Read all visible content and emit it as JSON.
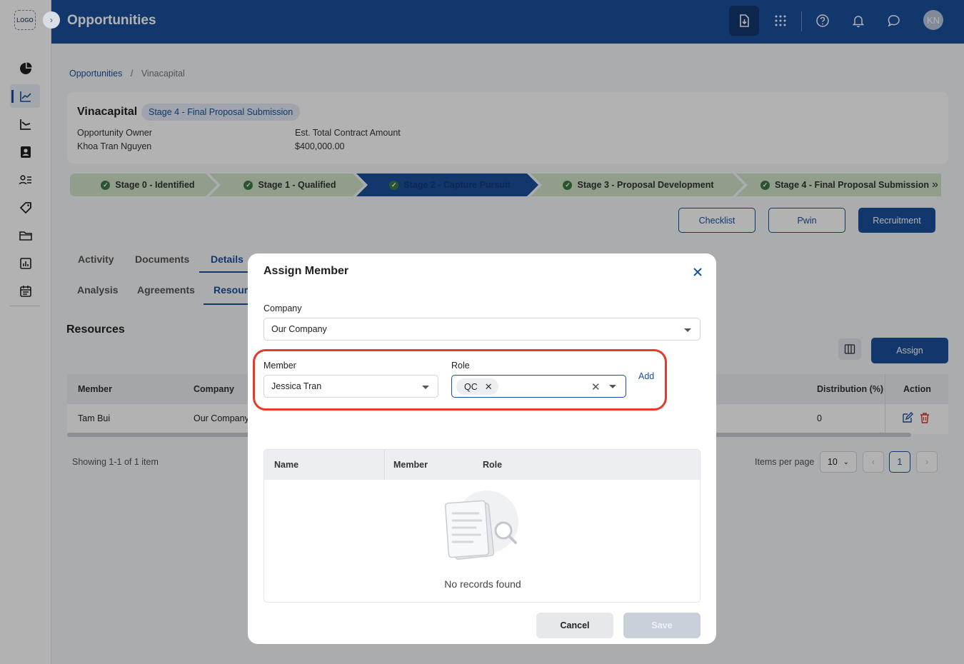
{
  "app": {
    "logo_text": "LOGO",
    "page_title": "Opportunities",
    "avatar_initials": "KN"
  },
  "sidebar": {
    "items": [
      {
        "icon": "dashboard-icon"
      },
      {
        "icon": "trend-chart-icon",
        "active": true
      },
      {
        "icon": "line-chart-icon"
      },
      {
        "icon": "contacts-icon"
      },
      {
        "icon": "people-list-icon"
      },
      {
        "icon": "tag-icon"
      },
      {
        "icon": "folder-icon"
      },
      {
        "icon": "report-icon"
      },
      {
        "icon": "calendar-icon"
      }
    ]
  },
  "header": {
    "icons": [
      "download-icon",
      "apps-grid-icon",
      "help-icon",
      "notification-bell-icon",
      "chat-icon"
    ]
  },
  "breadcrumb": {
    "root": "Opportunities",
    "separator": "/",
    "current": "Vinacapital"
  },
  "opportunity": {
    "name": "Vinacapital",
    "stage_badge": "Stage 4 - Final Proposal Submission",
    "owner_label": "Opportunity Owner",
    "owner_value": "Khoa Tran Nguyen",
    "amount_label": "Est. Total Contract Amount",
    "amount_value": "$400,000.00"
  },
  "stages": [
    {
      "label": "Stage 0 - Identified",
      "done": true
    },
    {
      "label": "Stage 1 - Qualified",
      "done": true
    },
    {
      "label": "Stage 2 - Capture Pursuit",
      "done": true,
      "current": true
    },
    {
      "label": "Stage 3 - Proposal Development",
      "done": true
    },
    {
      "label": "Stage 4 - Final Proposal Submission",
      "done": true
    }
  ],
  "actions": {
    "checklist": "Checklist",
    "pwin": "Pwin",
    "recruitment": "Recruitment"
  },
  "tabs": {
    "row1": [
      "Activity",
      "Documents",
      "Details"
    ],
    "row2": [
      "Analysis",
      "Agreements",
      "Resour"
    ]
  },
  "resources": {
    "title": "Resources",
    "assign_button": "Assign",
    "columns": {
      "member": "Member",
      "company": "Company",
      "distribution": "Distribution (%)",
      "action": "Action"
    },
    "rows": [
      {
        "member": "Tam Bui",
        "company": "Our Company",
        "distribution": "0"
      }
    ],
    "showing": "Showing 1-1 of 1 item",
    "items_per_page_label": "Items per page",
    "items_per_page": "10",
    "current_page": "1",
    "prev": "‹",
    "next": "›"
  },
  "modal": {
    "title": "Assign Member",
    "company_label": "Company",
    "company_value": "Our Company",
    "member_label": "Member",
    "member_value": "Jessica Tran",
    "role_label": "Role",
    "role_chip": "QC",
    "add_link": "Add",
    "table_columns": [
      "Name",
      "Member",
      "Role"
    ],
    "empty_text": "No records found",
    "cancel": "Cancel",
    "save": "Save"
  },
  "colors": {
    "primary": "#1a4f9c",
    "stage_done_bg": "#cfe3c7",
    "stage_current_bg": "#1a4f9c",
    "highlight": "#e53b2a"
  }
}
